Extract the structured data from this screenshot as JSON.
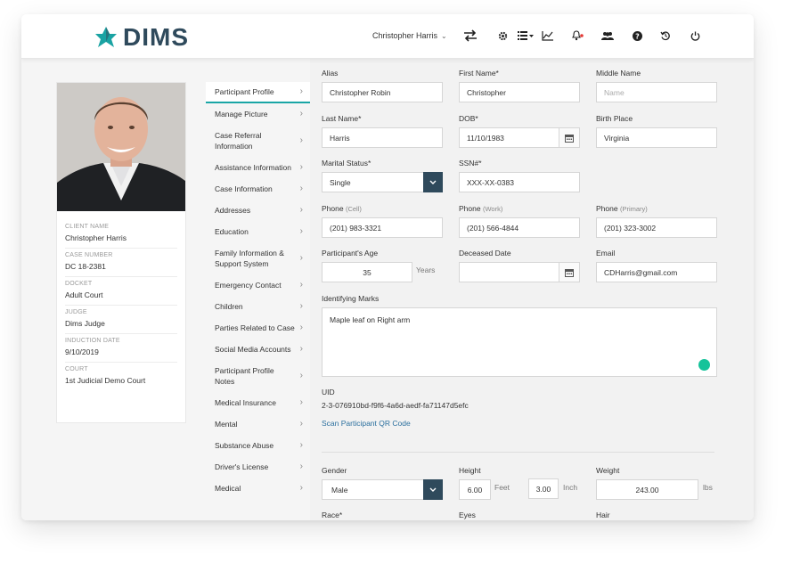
{
  "app": {
    "logo_text": "DIMS",
    "user_name": "Christopher Harris"
  },
  "topbar_icons": [
    "swap-icon",
    "gear-icon",
    "list-icon",
    "chart-icon",
    "bell-icon",
    "users-icon",
    "help-icon",
    "history-icon",
    "power-icon"
  ],
  "colors": {
    "accent": "#1aa6a6",
    "brand_dark": "#2f4a5c",
    "logo_teal": "#1aa3a3"
  },
  "profile": {
    "items": [
      {
        "label": "CLIENT NAME",
        "value": "Christopher Harris"
      },
      {
        "label": "CASE NUMBER",
        "value": "DC 18-2381"
      },
      {
        "label": "DOCKET",
        "value": "Adult Court"
      },
      {
        "label": "JUDGE",
        "value": "Dims Judge"
      },
      {
        "label": "INDUCTION DATE",
        "value": "9/10/2019"
      },
      {
        "label": "COURT",
        "value": "1st Judicial Demo Court"
      }
    ]
  },
  "menu": [
    "Participant Profile",
    "Manage Picture",
    "Case Referral Information",
    "Assistance Information",
    "Case Information",
    "Addresses",
    "Education",
    "Family Information & Support System",
    "Emergency Contact",
    "Children",
    "Parties Related to Case",
    "Social Media Accounts",
    "Participant Profile Notes",
    "Medical Insurance",
    "Mental",
    "Substance Abuse",
    "Driver's License",
    "Medical"
  ],
  "form": {
    "alias": {
      "label": "Alias",
      "value": "Christopher Robin"
    },
    "first_name": {
      "label": "First Name*",
      "value": "Christopher"
    },
    "middle_name": {
      "label": "Middle Name",
      "placeholder": "Name"
    },
    "last_name": {
      "label": "Last Name*",
      "value": "Harris"
    },
    "dob": {
      "label": "DOB*",
      "value": "11/10/1983"
    },
    "birth_place": {
      "label": "Birth Place",
      "value": "Virginia"
    },
    "marital_status": {
      "label": "Marital Status*",
      "value": "Single"
    },
    "ssn": {
      "label": "SSN#*",
      "value": "XXX-XX-0383"
    },
    "phone_cell": {
      "label": "Phone",
      "sub": "(Cell)",
      "value": "(201) 983-3321"
    },
    "phone_work": {
      "label": "Phone",
      "sub": "(Work)",
      "value": "(201) 566-4844"
    },
    "phone_primary": {
      "label": "Phone",
      "sub": "(Primary)",
      "value": "(201) 323-3002"
    },
    "age": {
      "label": "Participant's Age",
      "value": "35",
      "unit": "Years"
    },
    "deceased_date": {
      "label": "Deceased Date",
      "value": ""
    },
    "email": {
      "label": "Email",
      "value": "CDHarris@gmail.com"
    },
    "identifying_marks": {
      "label": "Identifying Marks",
      "value": "Maple leaf on Right arm"
    },
    "uid": {
      "label": "UID",
      "value": "2-3-076910bd-f9f6-4a6d-aedf-fa71147d5efc"
    },
    "scan_link": "Scan Participant QR Code",
    "gender": {
      "label": "Gender",
      "value": "Male"
    },
    "height": {
      "label": "Height",
      "feet": "6.00",
      "feet_unit": "Feet",
      "inch": "3.00",
      "inch_unit": "Inch"
    },
    "weight": {
      "label": "Weight",
      "value": "243.00",
      "unit": "lbs"
    },
    "race": {
      "label": "Race*"
    },
    "eyes": {
      "label": "Eyes"
    },
    "hair": {
      "label": "Hair"
    }
  }
}
